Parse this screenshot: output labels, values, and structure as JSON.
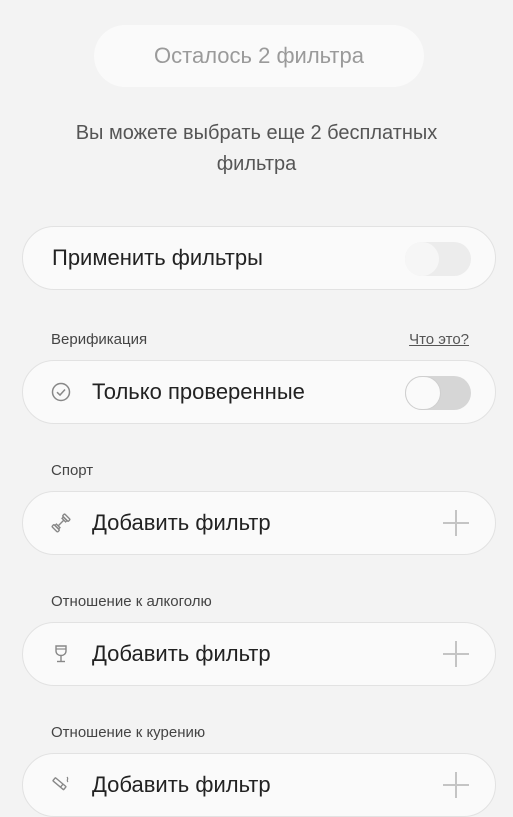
{
  "header": {
    "remaining_badge": "Осталось 2 фильтра",
    "description": "Вы можете выбрать еще 2 бесплатных фильтра"
  },
  "apply_filters": {
    "label": "Применить фильтры",
    "enabled": false
  },
  "verification": {
    "section_label": "Верификация",
    "info_link": "Что это?",
    "option_label": "Только проверенные",
    "enabled": false,
    "icon": "check-circle-icon"
  },
  "sport": {
    "section_label": "Спорт",
    "button_label": "Добавить фильтр",
    "icon": "dumbbell-icon"
  },
  "alcohol": {
    "section_label": "Отношение к алкоголю",
    "button_label": "Добавить фильтр",
    "icon": "wine-glass-icon"
  },
  "smoking": {
    "section_label": "Отношение к курению",
    "button_label": "Добавить фильтр",
    "icon": "cigarette-icon"
  }
}
